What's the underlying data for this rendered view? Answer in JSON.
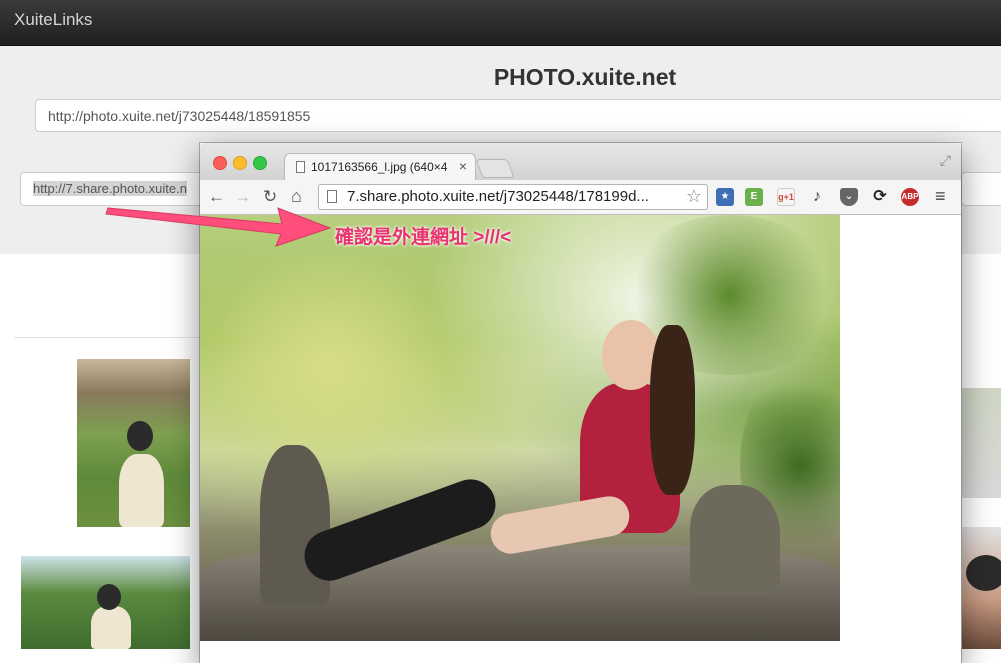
{
  "app": {
    "brand": "XuiteLinks"
  },
  "hero": {
    "title": "PHOTO.xuite.net",
    "url_value": "http://photo.xuite.net/j73025448/18591855",
    "result_value": "http://7.share.photo.xuite.n"
  },
  "popup": {
    "tab_title": "1017163566_l.jpg (640×4",
    "address": "7.share.photo.xuite.net/j73025448/178199d...",
    "extensions": [
      "bookmark-icon",
      "evernote-icon",
      "google-plus-icon",
      "music-icon",
      "pocket-icon",
      "sync-icon",
      "adblock-plus-icon"
    ],
    "ext_labels": {
      "gplus": "g+1",
      "abp": "ABP"
    }
  },
  "annotation": {
    "text": "確認是外連網址 >///<"
  },
  "colors": {
    "annotation": "#e8336f",
    "navbar": "#2a2a2a",
    "hero": "#eeeeee"
  }
}
